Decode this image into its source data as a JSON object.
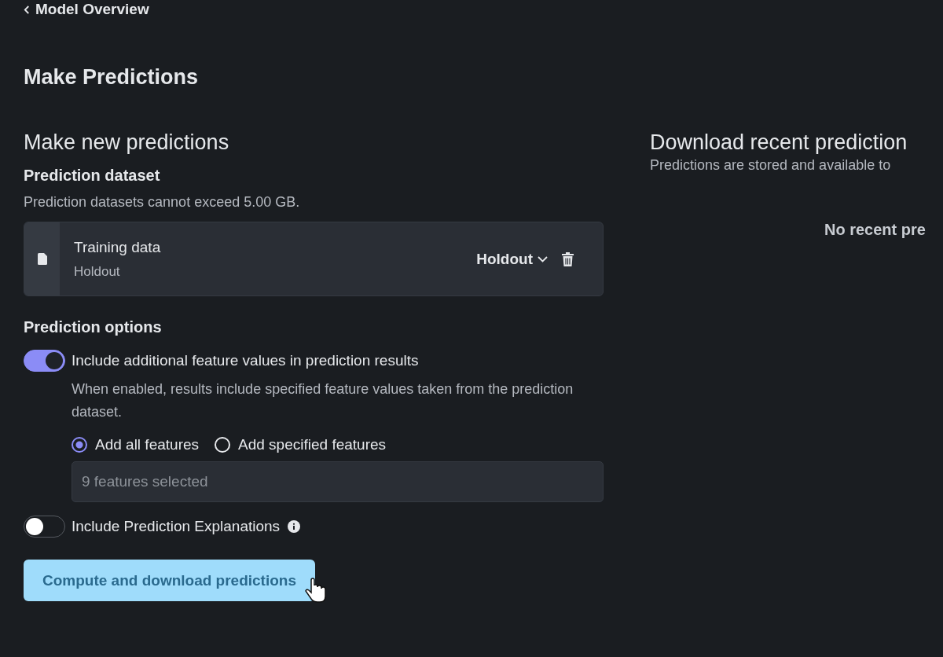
{
  "back_link": {
    "label": "Model Overview"
  },
  "page_title": "Make Predictions",
  "new_predictions": {
    "heading": "Make new predictions",
    "dataset": {
      "label": "Prediction dataset",
      "hint": "Prediction datasets cannot exceed 5.00 GB.",
      "file_name": "Training data",
      "partition": "Holdout",
      "partition_select": "Holdout"
    },
    "options": {
      "label": "Prediction options",
      "toggles": [
        {
          "label": "Include additional feature values in prediction results",
          "on": true,
          "description": "When enabled, results include specified feature values taken from the prediction dataset.",
          "radios": [
            {
              "label": "Add all features",
              "selected": true
            },
            {
              "label": "Add specified features",
              "selected": false
            }
          ],
          "field": {
            "value": "9 features selected"
          }
        },
        {
          "label": "Include Prediction Explanations",
          "on": false,
          "info": true
        }
      ]
    },
    "button": "Compute and download predictions"
  },
  "recent": {
    "heading": "Download recent prediction",
    "subtitle": "Predictions are stored and available to",
    "empty": "No recent pre"
  }
}
